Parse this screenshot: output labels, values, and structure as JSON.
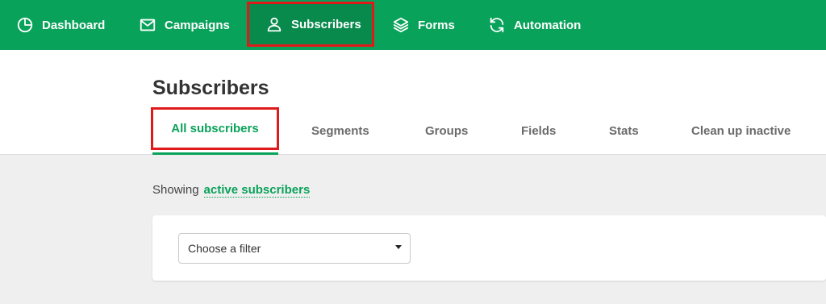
{
  "nav": {
    "items": [
      {
        "label": "Dashboard",
        "icon": "dashboard-pie-icon"
      },
      {
        "label": "Campaigns",
        "icon": "envelope-icon"
      },
      {
        "label": "Subscribers",
        "icon": "user-icon",
        "active": true
      },
      {
        "label": "Forms",
        "icon": "layers-icon"
      },
      {
        "label": "Automation",
        "icon": "refresh-icon"
      }
    ]
  },
  "page": {
    "title": "Subscribers",
    "tabs": [
      {
        "label": "All subscribers",
        "active": true
      },
      {
        "label": "Segments"
      },
      {
        "label": "Groups"
      },
      {
        "label": "Fields"
      },
      {
        "label": "Stats"
      },
      {
        "label": "Clean up inactive"
      }
    ]
  },
  "filter": {
    "showing_label": "Showing",
    "showing_link": "active subscribers",
    "select_value": "Choose a filter"
  },
  "colors": {
    "brand_green": "#09a25a",
    "highlight_red": "#e01a1a"
  }
}
